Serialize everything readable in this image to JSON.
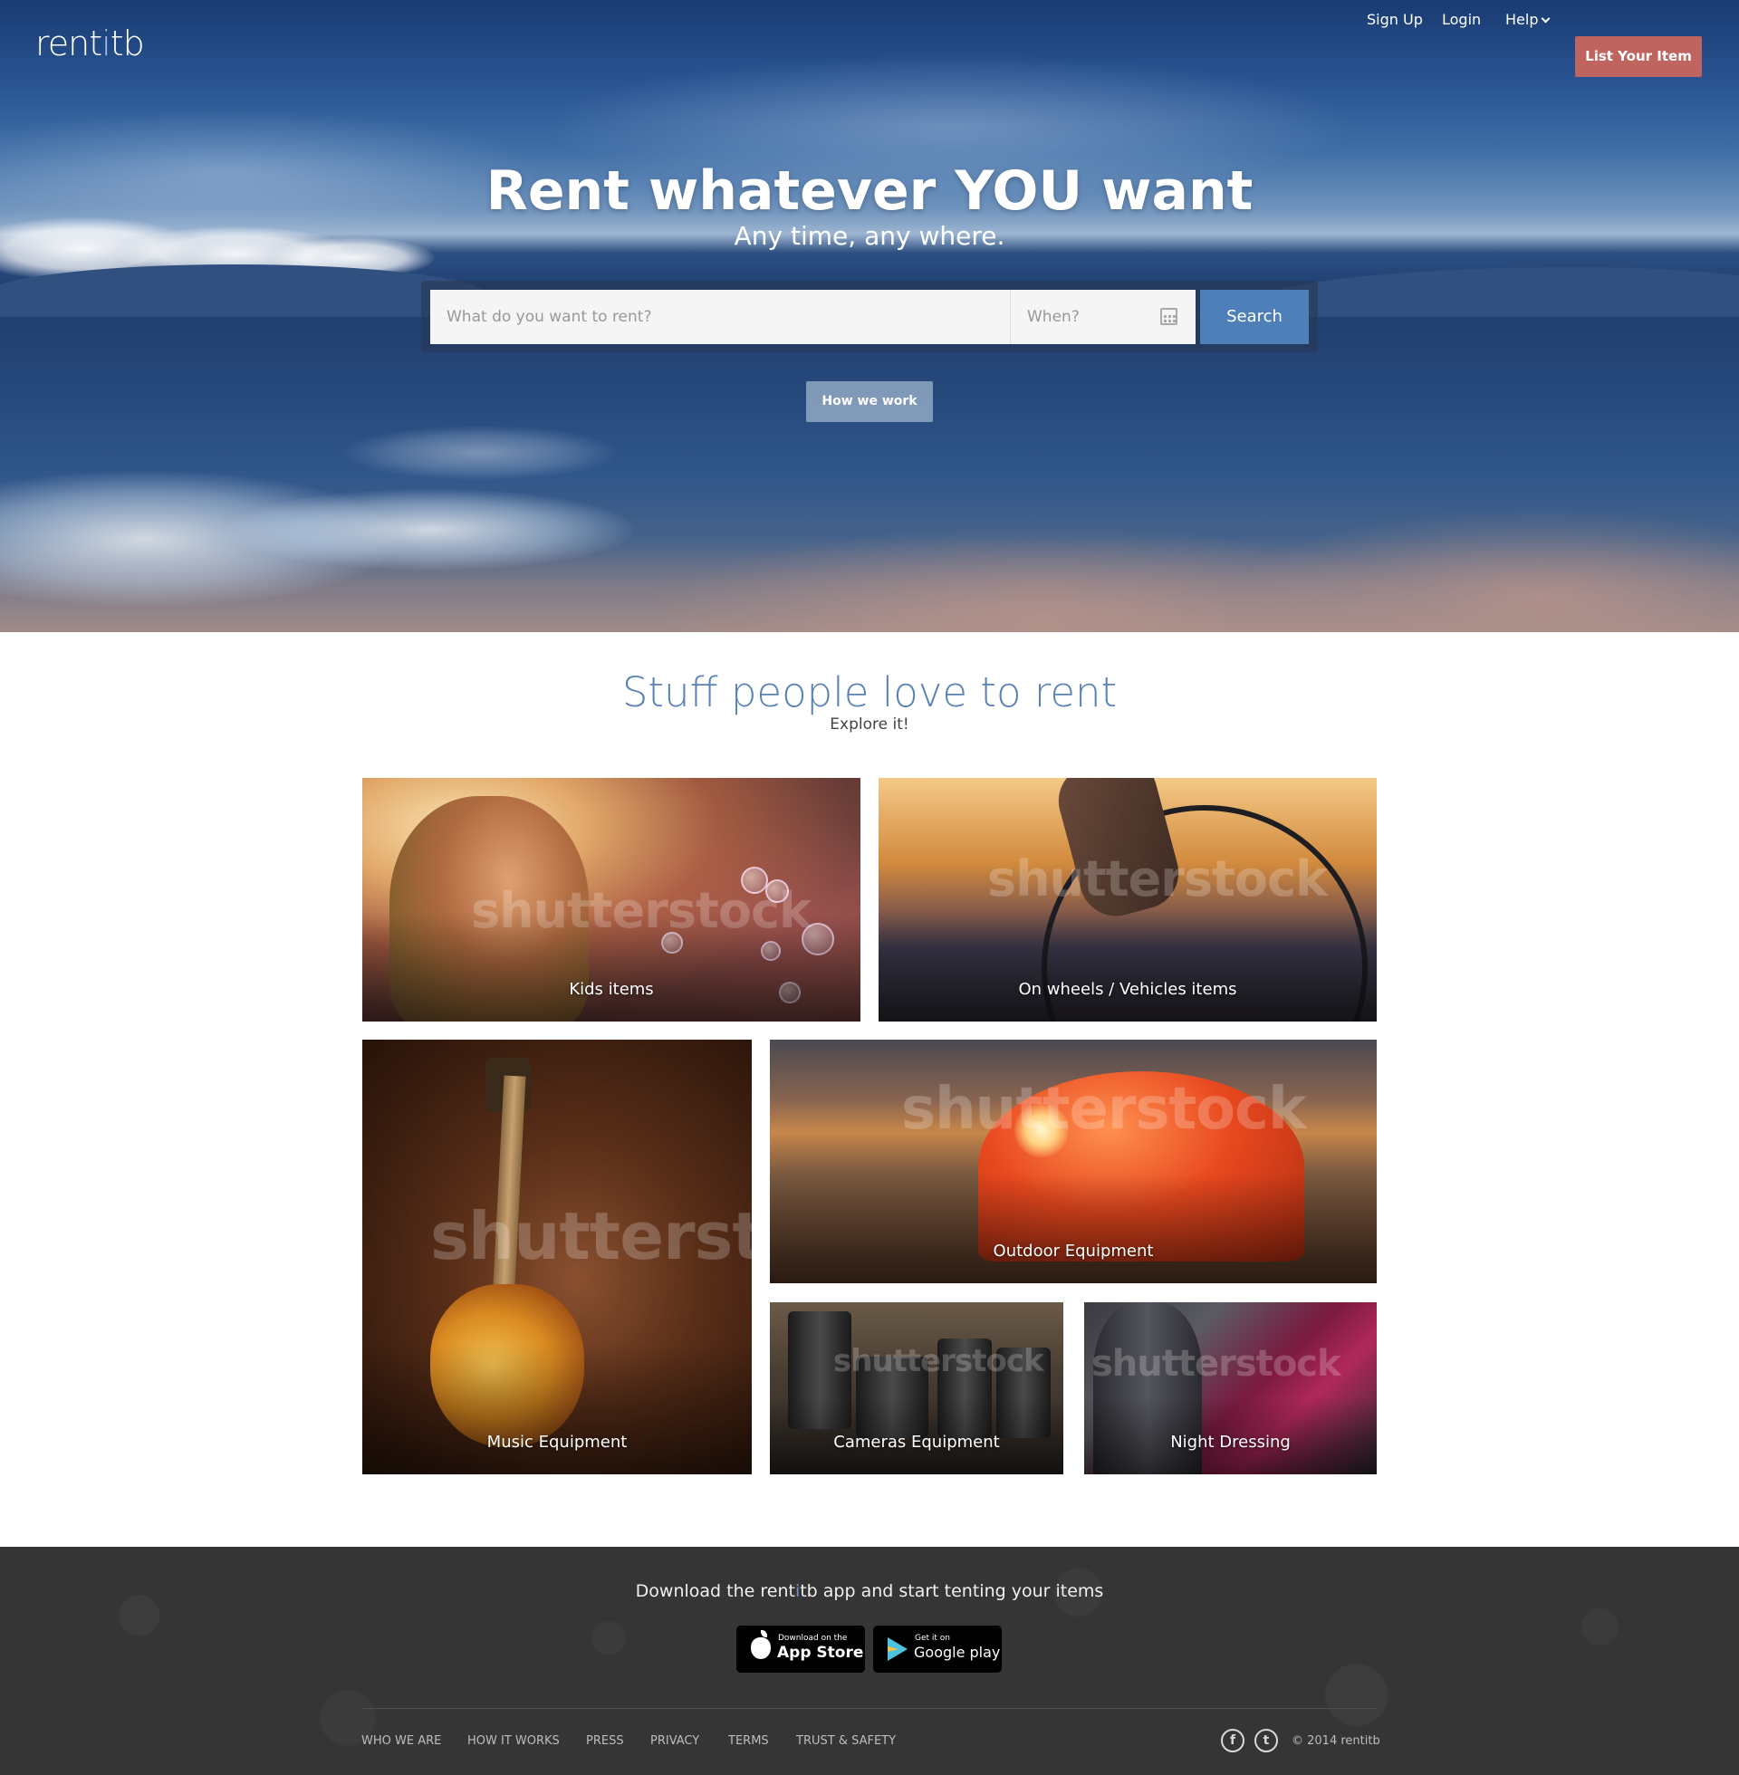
{
  "brand": {
    "logo_left": "rent",
    "logo_accent": "i",
    "logo_right": "tb"
  },
  "nav": {
    "signup": "Sign Up",
    "login": "Login",
    "help": "Help",
    "list_item": "List Your Item"
  },
  "hero": {
    "title": "Rent whatever YOU want",
    "subtitle": "Any time, any where.",
    "search_placeholder": "What do you want to rent?",
    "when_placeholder": "When?",
    "search_button": "Search",
    "how_we_work": "How we work"
  },
  "categories": {
    "title": "Stuff people love to rent",
    "subtitle": "Explore it!",
    "watermark": "shutterstock",
    "items": [
      {
        "label": "Kids items"
      },
      {
        "label": "On wheels / Vehicles items"
      },
      {
        "label": "Music Equipment"
      },
      {
        "label": "Outdoor Equipment"
      },
      {
        "label": "Cameras Equipment"
      },
      {
        "label": "Night Dressing"
      }
    ]
  },
  "footer": {
    "download_pre": "Download the rent",
    "download_accent": "i",
    "download_post": "tb app and start tenting your items",
    "app_store_small": "Download on the",
    "app_store_big": "App Store",
    "google_small": "Get it on",
    "google_big": "Google play",
    "links": [
      "WHO WE ARE",
      "HOW IT WORKS",
      "PRESS",
      "PRIVACY",
      "TERMS",
      "TRUST & SAFETY"
    ],
    "social_facebook": "f",
    "social_twitter": "t",
    "copyright": "© 2014 rentitb"
  },
  "colors": {
    "accent_blue": "#4f7fb8",
    "cta_red": "#c0645f",
    "footer_bg": "#353535"
  }
}
